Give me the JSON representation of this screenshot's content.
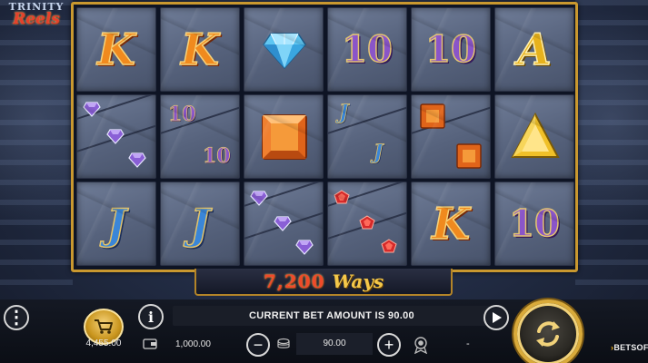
{
  "game": {
    "logo_line1": "TRINITY",
    "logo_line2": "Reels",
    "ways_number": "7,200",
    "ways_word": "Ways",
    "brand": "BETSOFT"
  },
  "reels": [
    [
      "K",
      "K",
      "diamond-gem",
      "10",
      "10",
      "A"
    ],
    [
      "double-purple-gems",
      "double-10",
      "orange-square-gem",
      "double-J",
      "double-orange-gems",
      "yellow-triangle-gem"
    ],
    [
      "J",
      "J",
      "triple-purple-gems",
      "triple-red-gems",
      "K",
      "10"
    ]
  ],
  "labels": {
    "K": "K",
    "A": "A",
    "J": "J",
    "ten": "10"
  },
  "hud": {
    "bet_message": "CURRENT BET AMOUNT IS 90.00",
    "balance": "4,455.00",
    "wallet": "1,000.00",
    "bet": "90.00",
    "win": "-"
  },
  "colors": {
    "frame_gold": "#c9982f",
    "ways_red": "#f04a2a",
    "ways_gold": "#f4c84a"
  }
}
